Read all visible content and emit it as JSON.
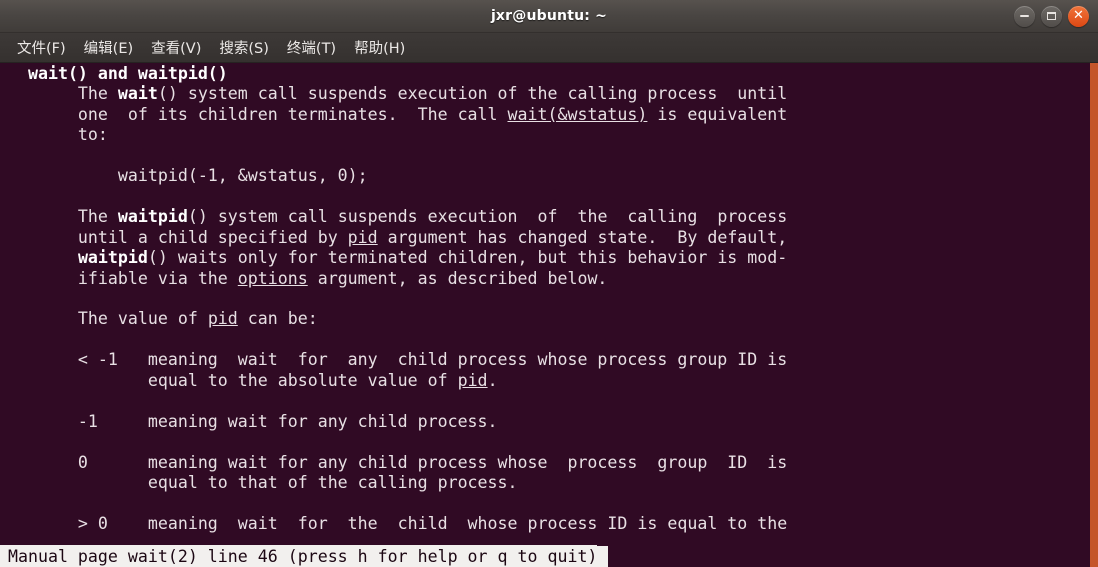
{
  "window": {
    "title": "jxr@ubuntu: ~",
    "controls": [
      {
        "name": "minimize",
        "label": "–"
      },
      {
        "name": "maximize",
        "label": "□"
      },
      {
        "name": "close",
        "label": "✕"
      }
    ],
    "colors": {
      "titlebar": "#4a4643",
      "terminal_bg": "#300a24",
      "terminal_fg": "#e8e0e4",
      "accent_border": "#c4552a",
      "close_button": "#dd4814",
      "status_bg": "#f2f0ee",
      "status_fg": "#1c0713"
    }
  },
  "menubar": {
    "items": [
      {
        "label": "文件(F)",
        "name": "file"
      },
      {
        "label": "编辑(E)",
        "name": "edit"
      },
      {
        "label": "查看(V)",
        "name": "view"
      },
      {
        "label": "搜索(S)",
        "name": "search"
      },
      {
        "label": "终端(T)",
        "name": "terminal"
      },
      {
        "label": "帮助(H)",
        "name": "help"
      }
    ]
  },
  "terminal": {
    "manpage": "wait(2)",
    "content_plain": "  wait() and waitpid()\n       The wait() system call suspends execution of the calling process  until\n       one  of its children terminates.  The call wait(&wstatus) is equivalent\n       to:\n\n           waitpid(-1, &wstatus, 0);\n\n       The waitpid() system call suspends execution  of  the  calling  process\n       until a child specified by pid argument has changed state.  By default,\n       waitpid() waits only for terminated children, but this behavior is mod-\n       ifiable via the options argument, as described below.\n\n       The value of pid can be:\n\n       < -1   meaning  wait  for  any  child process whose process group ID is\n              equal to the absolute value of pid.\n\n       -1     meaning wait for any child process.\n\n       0      meaning wait for any child process whose  process  group  ID  is\n              equal to that of the calling process.\n\n       > 0    meaning  wait  for  the  child  whose process ID is equal to the",
    "content_html": "  <span class=\"b\">wait() and waitpid()</span>\n       The <span class=\"b\">wait</span>() system call suspends execution of the calling process  until\n       one  of its children terminates.  The call <span class=\"u\">wait(&amp;wstatus)</span> is equivalent\n       to:\n\n           waitpid(-1, &amp;wstatus, 0);\n\n       The <span class=\"b\">waitpid</span>() system call suspends execution  of  the  calling  process\n       until a child specified by <span class=\"u\">pid</span> argument has changed state.  By default,\n       <span class=\"b\">waitpid</span>() waits only for terminated children, but this behavior is mod-\n       ifiable via the <span class=\"u\">options</span> argument, as described below.\n\n       The value of <span class=\"u\">pid</span> can be:\n\n       &lt; -1   meaning  wait  for  any  child process whose process group ID is\n              equal to the absolute value of <span class=\"u\">pid</span>.\n\n       -1     meaning wait for any child process.\n\n       0      meaning wait for any child process whose  process  group  ID  is\n              equal to that of the calling process.\n\n       &gt; 0    meaning  wait  for  the  child  whose process ID is equal to the",
    "lines": [
      "  wait() and waitpid()",
      "       The wait() system call suspends execution of the calling process  until",
      "       one  of its children terminates.  The call wait(&wstatus) is equivalent",
      "       to:",
      "",
      "           waitpid(-1, &wstatus, 0);",
      "",
      "       The waitpid() system call suspends execution  of  the  calling  process",
      "       until a child specified by pid argument has changed state.  By default,",
      "       waitpid() waits only for terminated children, but this behavior is mod-",
      "       ifiable via the options argument, as described below.",
      "",
      "       The value of pid can be:",
      "",
      "       < -1   meaning  wait  for  any  child process whose process group ID is",
      "              equal to the absolute value of pid.",
      "",
      "       -1     meaning wait for any child process.",
      "",
      "       0      meaning wait for any child process whose  process  group  ID  is",
      "              equal to that of the calling process.",
      "",
      "       > 0    meaning  wait  for  the  child  whose process ID is equal to the"
    ],
    "bold_spans": [
      "wait() and waitpid()",
      "wait",
      "waitpid"
    ],
    "underline_spans": [
      "wait(&wstatus)",
      "pid",
      "options"
    ]
  },
  "statusbar": {
    "text": "Manual page wait(2) line 46 (press h for help or q to quit)",
    "manual_page": "wait(2)",
    "line_number": "46",
    "hint": "press h for help or q to quit"
  }
}
